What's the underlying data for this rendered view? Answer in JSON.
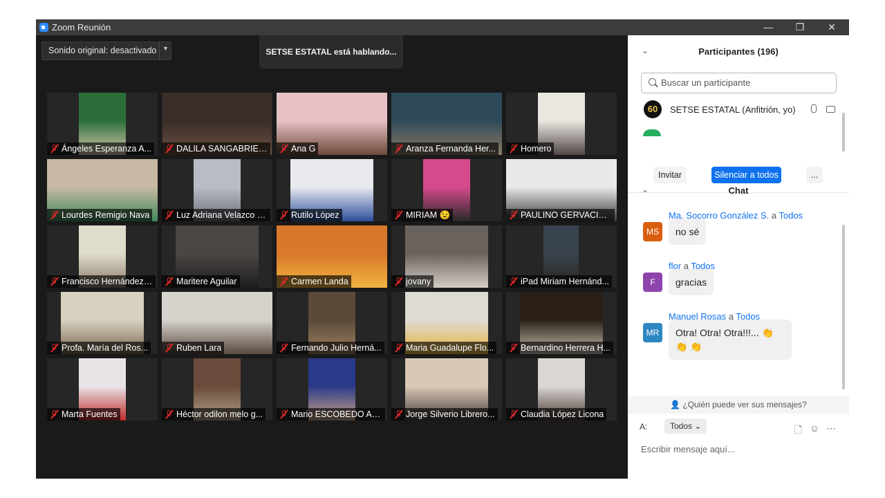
{
  "window": {
    "title": "Zoom Reunión",
    "controls": [
      "—",
      "❐",
      "✕"
    ]
  },
  "toolbar": {
    "audio_label": "Sonido original: desactivado",
    "speaking_banner": "SETSE ESTATAL está hablando..."
  },
  "participants_grid": [
    {
      "name": "Ángeles Esperanza A...",
      "muted": true
    },
    {
      "name": "DALILA SANGABRIEL ...",
      "muted": true
    },
    {
      "name": "Ana G",
      "muted": true
    },
    {
      "name": "Aranza Fernanda Her...",
      "muted": true
    },
    {
      "name": "Homero",
      "muted": true
    },
    {
      "name": "Lourdes Remigio Nava",
      "muted": true
    },
    {
      "name": "Luz Adriana Velazco F...",
      "muted": true
    },
    {
      "name": "Rutilo López",
      "muted": true
    },
    {
      "name": "MIRIAM 😉",
      "muted": true
    },
    {
      "name": "PAULINO GERVACIO ...",
      "muted": true
    },
    {
      "name": "Francisco Hernández ...",
      "muted": true
    },
    {
      "name": "Maritere Aguilar",
      "muted": true
    },
    {
      "name": "Carmen Landa",
      "muted": true
    },
    {
      "name": "jovany",
      "muted": true
    },
    {
      "name": "iPad Miriam Hernánd...",
      "muted": true
    },
    {
      "name": "Profa. María del Ros...",
      "muted": true
    },
    {
      "name": "Ruben Lara",
      "muted": true
    },
    {
      "name": "Fernando Julio Herná...",
      "muted": true
    },
    {
      "name": "Maria Guadalupe Flo...",
      "muted": true
    },
    {
      "name": "Bernardino Herrera H...",
      "muted": true
    },
    {
      "name": "Marta Fuentes",
      "muted": true
    },
    {
      "name": "Héctor odilon melo g...",
      "muted": true
    },
    {
      "name": "Mario ESCOBEDO AP...",
      "muted": true
    },
    {
      "name": "Jorge Silverio Librero...",
      "muted": true
    },
    {
      "name": "Claudia López Licona",
      "muted": true
    }
  ],
  "participants_panel": {
    "title": "Participantes (196)",
    "search_placeholder": "Buscar un participante",
    "host_row": {
      "avatar_text": "60",
      "name": "SETSE ESTATAL (Anfitrión, yo)"
    },
    "invite_label": "Invitar",
    "mute_all_label": "Silenciar a todos",
    "more_label": "..."
  },
  "chat": {
    "title": "Chat",
    "messages": [
      {
        "sender": "Ma. Socorro González S.",
        "connector": "a",
        "recipient": "Todos",
        "initials": "MS",
        "avatar_color": "#d95f0e",
        "text": "no sé"
      },
      {
        "sender": "flor",
        "connector": "a",
        "recipient": "Todos",
        "initials": "F",
        "avatar_color": "#8e44ad",
        "text": "gracias"
      },
      {
        "sender": "Manuel Rosas",
        "connector": "a",
        "recipient": "Todos",
        "initials": "MR",
        "avatar_color": "#2e86c1",
        "text": "Otra! Otra! Otra!!!... 👏👏 👏"
      }
    ],
    "who_can_see": "¿Quién puede ver sus mensajes?",
    "to_label": "A:",
    "to_value": "Todos",
    "input_placeholder": "Escribir mensaje aquí..."
  },
  "colors": {
    "accent": "#0e72ed",
    "mute_red": "#e02828",
    "background": "#1a1a1a"
  }
}
